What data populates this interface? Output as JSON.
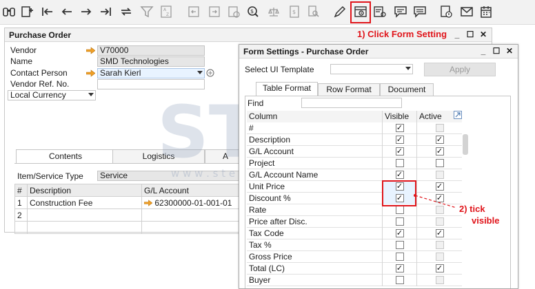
{
  "colors": {
    "annotation": "#e0141a",
    "field_bg": "#e6e6e6",
    "highlight": "#e8f3ff",
    "link_arrow": "#f0a028"
  },
  "toolbar": {
    "icons": [
      "binoculars-icon",
      "add-document-icon",
      "first-record-icon",
      "previous-record-icon",
      "next-record-icon",
      "last-record-icon",
      "refresh-icon",
      "filter-icon",
      "sort-icon",
      "base-document-icon",
      "target-document-icon",
      "gross-profit-icon",
      "payment-means-icon",
      "volume-weight-icon",
      "journal-entry-icon",
      "query-icon",
      "edit-icon",
      "form-settings-icon",
      "layout-designer-icon",
      "messages-icon",
      "alerts-icon",
      "approval-icon",
      "mail-icon",
      "calendar-icon"
    ]
  },
  "annotations": {
    "step1": "1) Click Form Setting",
    "step2_line1": "2) tick",
    "step2_line2": "visible"
  },
  "purchase_order": {
    "title": "Purchase Order",
    "fields": {
      "vendor_label": "Vendor",
      "vendor_value": "V70000",
      "name_label": "Name",
      "name_value": "SMD Technologies",
      "contact_label": "Contact Person",
      "contact_value": "Sarah Kierl",
      "vendor_ref_label": "Vendor Ref. No.",
      "vendor_ref_value": "",
      "currency_value": "Local Currency"
    },
    "tabs": [
      "Contents",
      "Logistics",
      "A"
    ],
    "item_service_type_label": "Item/Service Type",
    "item_service_type_value": "Service",
    "grid": {
      "headers": [
        "#",
        "Description",
        "G/L Account"
      ],
      "rows": [
        {
          "num": "1",
          "description": "Construction Fee",
          "gl_account": "62300000-01-001-01"
        },
        {
          "num": "2",
          "description": "",
          "gl_account": ""
        }
      ]
    }
  },
  "form_settings": {
    "title": "Form Settings - Purchase Order",
    "select_template_label": "Select UI Template",
    "select_template_value": "",
    "apply_label": "Apply",
    "tabs": [
      "Table Format",
      "Row Format",
      "Document"
    ],
    "find_label": "Find",
    "find_value": "",
    "columns_header": {
      "column": "Column",
      "visible": "Visible",
      "active": "Active"
    },
    "rows": [
      {
        "column": "#",
        "visible": true,
        "active": false,
        "active_disabled": true
      },
      {
        "column": "Description",
        "visible": true,
        "active": true,
        "active_disabled": false
      },
      {
        "column": "G/L Account",
        "visible": true,
        "active": true,
        "active_disabled": false
      },
      {
        "column": "Project",
        "visible": false,
        "active": false,
        "active_disabled": false
      },
      {
        "column": "G/L Account Name",
        "visible": true,
        "active": false,
        "active_disabled": true
      },
      {
        "column": "Unit Price",
        "visible": true,
        "active": true,
        "active_disabled": false
      },
      {
        "column": "Discount %",
        "visible": true,
        "active": true,
        "active_disabled": false
      },
      {
        "column": "Rate",
        "visible": false,
        "active": false,
        "active_disabled": true
      },
      {
        "column": "Price after Disc.",
        "visible": false,
        "active": false,
        "active_disabled": true
      },
      {
        "column": "Tax Code",
        "visible": true,
        "active": true,
        "active_disabled": false
      },
      {
        "column": "Tax %",
        "visible": false,
        "active": false,
        "active_disabled": true
      },
      {
        "column": "Gross Price",
        "visible": false,
        "active": false,
        "active_disabled": true
      },
      {
        "column": "Total (LC)",
        "visible": true,
        "active": true,
        "active_disabled": false
      },
      {
        "column": "Buyer",
        "visible": false,
        "active": false,
        "active_disabled": true
      }
    ]
  },
  "watermark": {
    "brand": "STEM",
    "url": "w w w . s t e r l i n g t e a m . c o m"
  }
}
